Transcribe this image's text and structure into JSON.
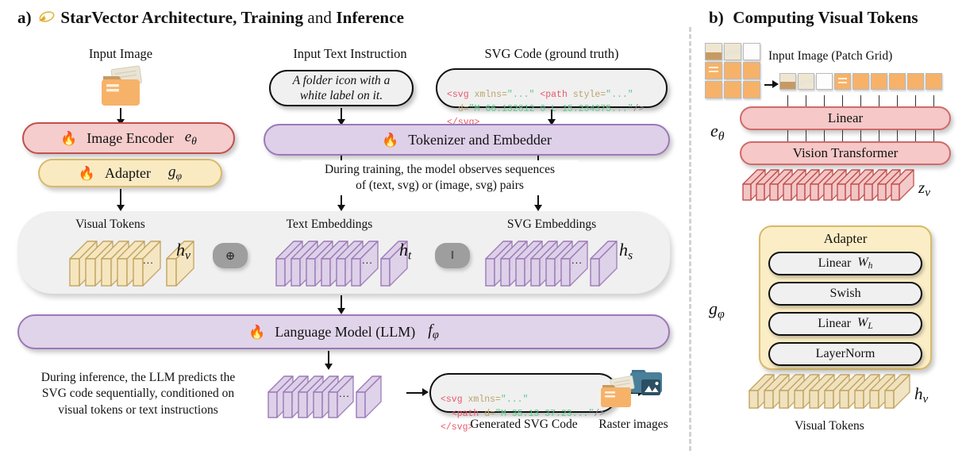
{
  "panel_a": {
    "label": "a)",
    "title_bold_1": "StarVector Architecture, Training",
    "title_thin": " and ",
    "title_bold_2": "Inference",
    "star_icon": "comet-icon",
    "input_image_caption": "Input Image",
    "input_image_icon": "folder-icon",
    "text_instruction_caption": "Input Text Instruction",
    "text_instruction_value": "A folder icon with a\nwhite label on it.",
    "svg_gt_caption": "SVG Code (ground truth)",
    "svg_gt_code": {
      "line1_tag": "<svg",
      "line1_attr": " xmlns=",
      "line1_str": "\"...\"",
      "line1_tag2": "<path",
      "line1_attr2": " style=",
      "line1_str2": "\"...\"",
      "line2_attr": "d=",
      "line2_str": "\"M 66.132812 0 L 15.234375...\"",
      "line2_close": "/>",
      "line3": "</svg>"
    },
    "image_encoder": {
      "label": "Image Encoder",
      "symbol": "e",
      "subscript": "θ",
      "flame": "fire-icon"
    },
    "adapter": {
      "label": "Adapter",
      "symbol": "g",
      "subscript": "φ",
      "flame": "fire-icon"
    },
    "tokenizer": {
      "label": "Tokenizer and  Embedder",
      "flame": "fire-icon"
    },
    "training_note": "During training, the model observes sequences\nof (text, svg) or (image, svg) pairs",
    "visual_tokens": {
      "caption": "Visual Tokens",
      "symbol": "h",
      "subscript": "v",
      "count": 6,
      "color": "#f6e6c0",
      "border": "#c2a45e"
    },
    "text_embeddings": {
      "caption": "Text Embeddings",
      "symbol": "h",
      "subscript": "t",
      "count": 7,
      "color": "#ddd0e8",
      "border": "#9b79b8"
    },
    "svg_embeddings": {
      "caption": "SVG Embeddings",
      "symbol": "h",
      "subscript": "s",
      "count": 7,
      "color": "#ddd0e8",
      "border": "#9b79b8"
    },
    "op_add": "⊕",
    "op_concat": "‖",
    "llm": {
      "label": "Language Model (LLM)",
      "symbol": "f",
      "subscript": "φ",
      "flame": "fire-icon"
    },
    "inference_note": "During inference, the LLM predicts the\nSVG code sequentially, conditioned on\nvisual tokens or text instructions",
    "output_tokens": {
      "count": 6,
      "color": "#ddd0e8",
      "border": "#9b79b8"
    },
    "generated_code": {
      "line1_tag": "<svg",
      "line1_attr": " xmlns=",
      "line1_str": "\"...\"",
      "line2_tag": "<path",
      "line2_attr": " d=",
      "line2_str": "\"M 35.13 37.23...\"",
      "line2_close": "/>",
      "line3": "</svg>"
    },
    "generated_caption": "Generated SVG Code",
    "raster_caption": "Raster images",
    "raster_icons": [
      "folder-icon",
      "image-folder-icon"
    ],
    "ellipsis": "..."
  },
  "panel_b": {
    "label": "b)",
    "title": "Computing Visual Tokens",
    "patch_grid_caption": "Input Image (Patch Grid)",
    "encoder_symbol": "e",
    "encoder_subscript": "θ",
    "linear": "Linear",
    "vision_transformer": "Vision Transformer",
    "zv_symbol": "z",
    "zv_subscript": "v",
    "adapter_title": "Adapter",
    "adapter_symbol": "g",
    "adapter_subscript": "φ",
    "adapter_layers": [
      {
        "label": "Linear",
        "weight": "W",
        "weight_sub": "h"
      },
      {
        "label": "Swish",
        "weight": "",
        "weight_sub": ""
      },
      {
        "label": "Linear",
        "weight": "W",
        "weight_sub": "L"
      },
      {
        "label": "LayerNorm",
        "weight": "",
        "weight_sub": ""
      }
    ],
    "hv_symbol": "h",
    "hv_subscript": "v",
    "visual_tokens_caption": "Visual Tokens",
    "patch_count": 9,
    "zv_count": 12,
    "hv_count": 10
  },
  "colors": {
    "pink_fill": "#f6cdcd",
    "pink_border": "#c0504d",
    "tan_fill": "#faeac2",
    "tan_border": "#d9b96a",
    "purple_fill": "#ddd0e8",
    "purple_border": "#9b79b8",
    "grey_stage": "#f0f0f0",
    "op_grey": "#9e9e9e",
    "orange": "#f7b269",
    "teal": "#4a7f99",
    "code_tag": "#e8596b",
    "code_string": "#5fc98f",
    "code_attr": "#b9a46a"
  }
}
